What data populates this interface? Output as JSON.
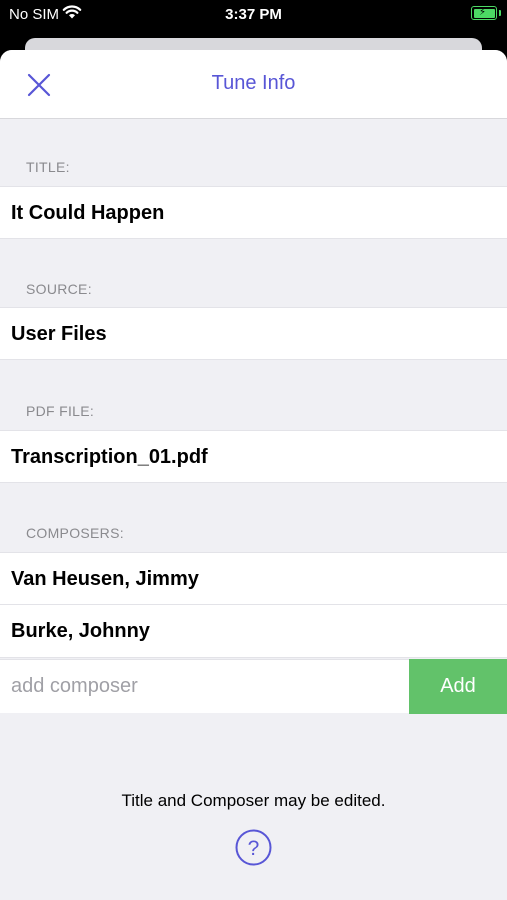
{
  "status_bar": {
    "carrier": "No SIM",
    "time": "3:37 PM"
  },
  "nav": {
    "title": "Tune Info"
  },
  "fields": {
    "title": {
      "label": "TITLE:",
      "value": "It Could Happen"
    },
    "source": {
      "label": "SOURCE:",
      "value": "User Files"
    },
    "pdf": {
      "label": "PDF FILE:",
      "value": "Transcription_01.pdf"
    }
  },
  "composers": {
    "label": "COMPOSERS:",
    "items": [
      "Van Heusen, Jimmy",
      "Burke, Johnny"
    ],
    "input_placeholder": "add composer",
    "add_label": "Add"
  },
  "footer": {
    "note": "Title and Composer may be edited."
  },
  "colors": {
    "accent": "#5856d6",
    "add_button": "#62c26a",
    "background": "#f0f0f4"
  }
}
